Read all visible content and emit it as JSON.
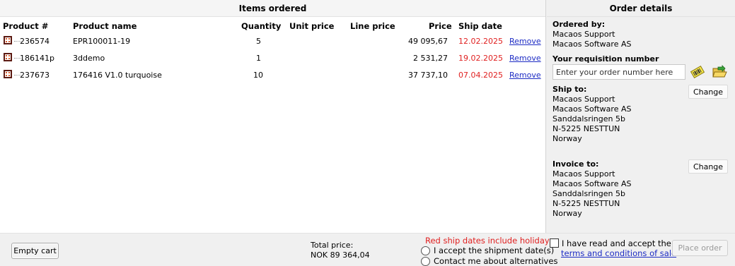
{
  "items_panel": {
    "title": "Items ordered",
    "columns": {
      "product_no": "Product #",
      "product_name": "Product name",
      "quantity": "Quantity",
      "unit_price": "Unit price",
      "line_price": "Line price",
      "price": "Price",
      "ship_date": "Ship date"
    },
    "rows": [
      {
        "icon": "product-icon",
        "product_no": "236574",
        "product_name": "EPR100011-19",
        "quantity": "5",
        "unit_price": "",
        "line_price": "",
        "price": "49 095,67",
        "ship_date": "12.02.2025",
        "action": "Remove"
      },
      {
        "icon": "product-icon",
        "product_no": "186141p",
        "product_name": "3ddemo",
        "quantity": "1",
        "unit_price": "",
        "line_price": "",
        "price": "2 531,27",
        "ship_date": "19.02.2025",
        "action": "Remove"
      },
      {
        "icon": "product-icon",
        "product_no": "237673",
        "product_name": "176416 V1.0 turquoise",
        "quantity": "10",
        "unit_price": "",
        "line_price": "",
        "price": "37 737,10",
        "ship_date": "07.04.2025",
        "action": "Remove"
      }
    ]
  },
  "order_details": {
    "title": "Order details",
    "ordered_by_label": "Ordered by:",
    "ordered_by": [
      "Macaos Support",
      "Macaos Software AS"
    ],
    "requisition_label": "Your requisition number",
    "requisition_placeholder": "Enter your order number here",
    "requisition_icons": [
      "barcode-scan-icon",
      "folder-open-icon"
    ],
    "ship_to_label": "Ship to:",
    "ship_to": [
      "Macaos Support",
      "Macaos Software AS",
      "Sanddalsringen 5b",
      "N-5225 NESTTUN",
      "Norway"
    ],
    "invoice_to_label": "Invoice to:",
    "invoice_to": [
      "Macaos Support",
      "Macaos Software AS",
      "Sanddalsringen 5b",
      "N-5225 NESTTUN",
      "Norway"
    ],
    "change_label": "Change"
  },
  "footer": {
    "empty_cart": "Empty cart",
    "total_label": "Total price:",
    "total_value": "NOK 89 364,04",
    "holiday_note": "Red ship dates include holidays",
    "accept_shipment": "I accept the shipment date(s)",
    "contact_alternatives": "Contact me about alternatives",
    "terms_text": "I have read and accept the",
    "terms_link": "terms and conditions of sale",
    "place_order": "Place order"
  },
  "colors": {
    "ship_date_red": "#e02020",
    "link_blue": "#1c2bc4",
    "disabled_text": "#9a9a9a"
  }
}
